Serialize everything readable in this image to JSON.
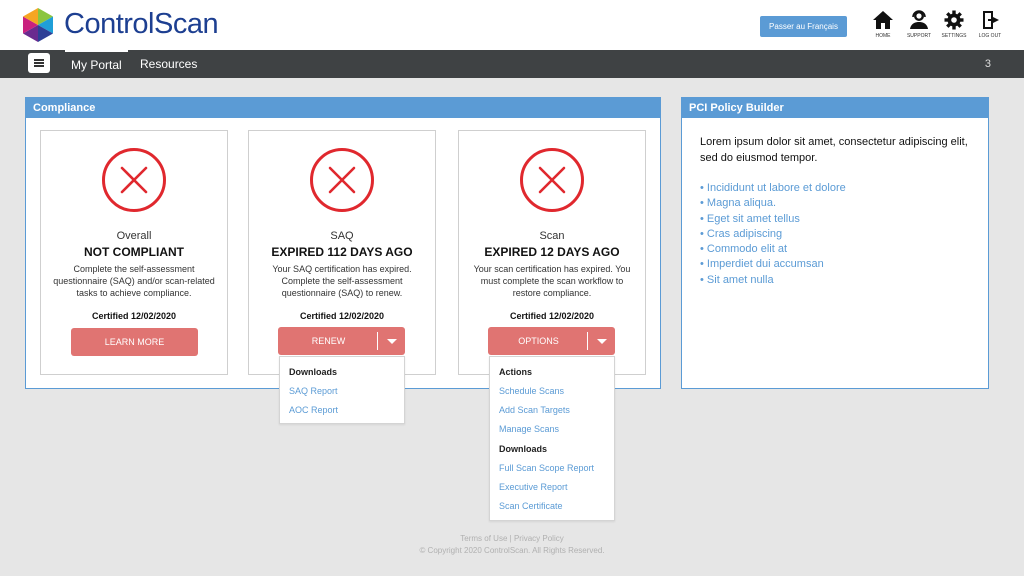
{
  "header": {
    "brand": "ControlScan",
    "lang_button": "Passer au Français",
    "icons": [
      {
        "name": "home-icon",
        "label": "HOME"
      },
      {
        "name": "support-icon",
        "label": "SUPPORT"
      },
      {
        "name": "settings-icon",
        "label": "SETTINGS"
      },
      {
        "name": "logout-icon",
        "label": "LOG OUT"
      }
    ]
  },
  "nav": {
    "items": [
      "My Portal",
      "Resources"
    ],
    "count": "3"
  },
  "compliance": {
    "title": "Compliance",
    "cards": [
      {
        "type": "Overall",
        "status": "NOT COMPLIANT",
        "desc": "Complete the self-assessment questionnaire (SAQ) and/or scan-related tasks to achieve compliance.",
        "certified": "Certified 12/02/2020",
        "button": "LEARN  MORE"
      },
      {
        "type": "SAQ",
        "status": "EXPIRED 112 DAYS AGO",
        "desc": "Your SAQ certification has expired. Complete the self-assessment questionnaire (SAQ) to renew.",
        "certified": "Certified 12/02/2020",
        "button": "RENEW"
      },
      {
        "type": "Scan",
        "status": "EXPIRED 12 DAYS AGO",
        "desc": "Your scan certification has expired. You must complete the scan workflow to restore compliance.",
        "certified": "Certified 12/02/2020",
        "button": "OPTIONS"
      }
    ],
    "saq_dropdown": {
      "heading": "Downloads",
      "links": [
        "SAQ Report",
        "AOC Report"
      ]
    },
    "scan_dropdown": {
      "actions_heading": "Actions",
      "actions": [
        "Schedule Scans",
        "Add Scan Targets",
        "Manage Scans"
      ],
      "downloads_heading": "Downloads",
      "downloads": [
        "Full Scan Scope Report",
        "Executive Report",
        "Scan Certificate"
      ]
    }
  },
  "pci": {
    "title": "PCI Policy Builder",
    "intro": "Lorem ipsum dolor sit amet, consectetur adipiscing elit, sed do eiusmod tempor.",
    "items": [
      "Incididunt ut labore et dolore",
      "Magna aliqua.",
      "Eget sit amet tellus",
      "Cras adipiscing",
      "Commodo  elit at",
      "Imperdiet dui accumsan",
      "Sit amet nulla"
    ]
  },
  "footer": {
    "terms": "Terms of Use",
    "sep": "|",
    "privacy": "Privacy Policy",
    "copyright": "© Copyright 2020 ControlScan. All Rights Reserved."
  },
  "colors": {
    "accent": "#5b9bd5",
    "alert": "#e0282e",
    "button": "#e07472",
    "brand": "#1d3f91",
    "navbar": "#3f4244"
  }
}
